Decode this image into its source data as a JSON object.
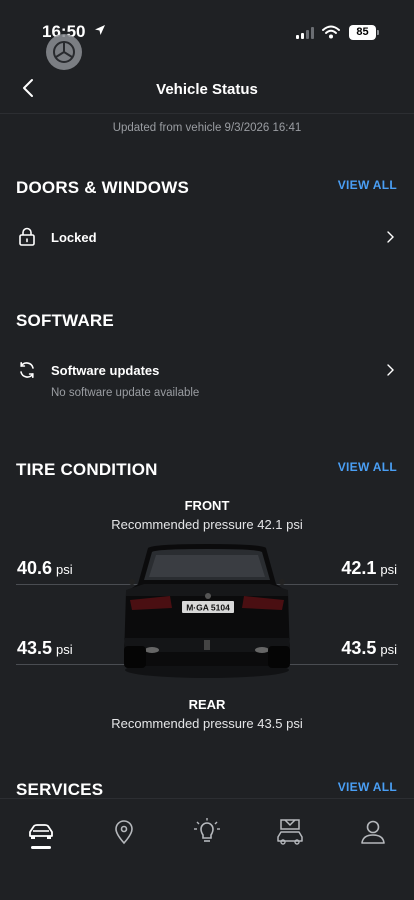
{
  "status_bar": {
    "time": "16:50",
    "battery": "85"
  },
  "nav": {
    "title": "Vehicle Status"
  },
  "updated_text": "Updated from vehicle 9/3/2026 16:41",
  "doors_windows": {
    "title": "DOORS & WINDOWS",
    "view_all": "VIEW ALL",
    "status": "Locked"
  },
  "software": {
    "title": "SOFTWARE",
    "label": "Software updates",
    "sub": "No software update available"
  },
  "tires": {
    "title": "TIRE CONDITION",
    "view_all": "VIEW ALL",
    "front_label": "FRONT",
    "front_recommended": "Recommended pressure 42.1 psi",
    "rear_label": "REAR",
    "rear_recommended": "Recommended pressure 43.5 psi",
    "front_left": "40.6",
    "front_right": "42.1",
    "rear_left": "43.5",
    "rear_right": "43.5",
    "unit": "psi",
    "license_plate": "M·GA 5104"
  },
  "services": {
    "title": "SERVICES",
    "view_all": "VIEW ALL"
  },
  "tabs": [
    "car-icon",
    "location-pin-icon",
    "bulb-icon",
    "car-service-icon",
    "profile-icon"
  ],
  "colors": {
    "background": "#1f2124",
    "accent": "#4a9ff5",
    "muted_text": "#9a9da2"
  }
}
